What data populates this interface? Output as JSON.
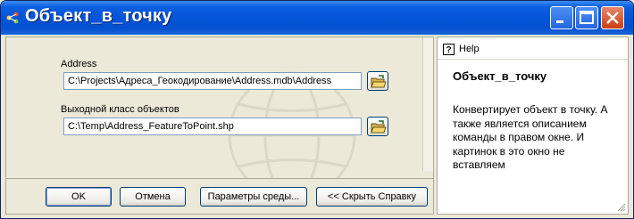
{
  "window": {
    "title": "Объект_в_точку"
  },
  "form": {
    "input_label": "Address",
    "input_value": "C:\\Projects\\Адреса_Геокодирование\\Address.mdb\\Address",
    "output_label": "Выходной класс объектов",
    "output_value": "C:\\Temp\\Address_FeatureToPoint.shp"
  },
  "buttons": {
    "ok": "OK",
    "cancel": "Отмена",
    "env": "Параметры среды...",
    "hide_help": "<< Скрыть Справку"
  },
  "help": {
    "tab_label": "Help",
    "title": "Объект_в_точку",
    "body": "Конвертирует объект в точку. А также является описанием команды в правом окне. И картинок в это окно не вставляем"
  },
  "colors": {
    "titlebar": "#0454d8",
    "close": "#c93e14",
    "panel": "#ece9d8"
  }
}
